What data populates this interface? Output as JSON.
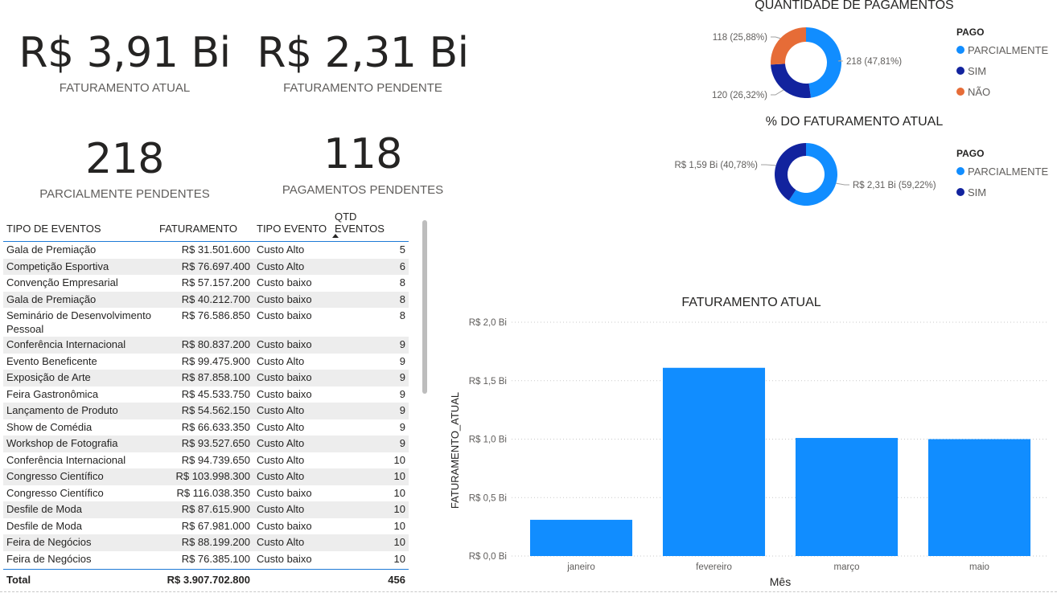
{
  "kpis": {
    "faturamento_atual": {
      "value": "R$ 3,91 Bi",
      "label": "FATURAMENTO ATUAL"
    },
    "faturamento_pendente": {
      "value": "R$ 2,31 Bi",
      "label": "FATURAMENTO PENDENTE"
    },
    "parcialmente_pendentes": {
      "value": "218",
      "label": "PARCIALMENTE PENDENTES"
    },
    "pagamentos_pendentes": {
      "value": "118",
      "label": "PAGAMENTOS PENDENTES"
    }
  },
  "colors": {
    "parcialmente": "#118DFF",
    "sim": "#12239E",
    "nao": "#E66C37"
  },
  "table": {
    "headers": [
      "TIPO DE EVENTOS",
      "FATURAMENTO",
      "TIPO EVENTO",
      "QTD EVENTOS"
    ],
    "rows": [
      [
        "Gala de Premiação",
        "R$ 31.501.600",
        "Custo Alto",
        "5"
      ],
      [
        "Competição Esportiva",
        "R$ 76.697.400",
        "Custo Alto",
        "6"
      ],
      [
        "Convenção Empresarial",
        "R$ 57.157.200",
        "Custo baixo",
        "8"
      ],
      [
        "Gala de Premiação",
        "R$ 40.212.700",
        "Custo baixo",
        "8"
      ],
      [
        "Seminário de Desenvolvimento Pessoal",
        "R$ 76.586.850",
        "Custo baixo",
        "8"
      ],
      [
        "Conferência Internacional",
        "R$ 80.837.200",
        "Custo baixo",
        "9"
      ],
      [
        "Evento Beneficente",
        "R$ 99.475.900",
        "Custo Alto",
        "9"
      ],
      [
        "Exposição de Arte",
        "R$ 87.858.100",
        "Custo baixo",
        "9"
      ],
      [
        "Feira Gastronômica",
        "R$ 45.533.750",
        "Custo baixo",
        "9"
      ],
      [
        "Lançamento de Produto",
        "R$ 54.562.150",
        "Custo Alto",
        "9"
      ],
      [
        "Show de Comédia",
        "R$ 66.633.350",
        "Custo Alto",
        "9"
      ],
      [
        "Workshop de Fotografia",
        "R$ 93.527.650",
        "Custo Alto",
        "9"
      ],
      [
        "Conferência Internacional",
        "R$ 94.739.650",
        "Custo Alto",
        "10"
      ],
      [
        "Congresso Científico",
        "R$ 103.998.300",
        "Custo Alto",
        "10"
      ],
      [
        "Congresso Científico",
        "R$ 116.038.350",
        "Custo baixo",
        "10"
      ],
      [
        "Desfile de Moda",
        "R$ 87.615.900",
        "Custo Alto",
        "10"
      ],
      [
        "Desfile de Moda",
        "R$ 67.981.000",
        "Custo baixo",
        "10"
      ],
      [
        "Feira de Negócios",
        "R$ 88.199.200",
        "Custo Alto",
        "10"
      ],
      [
        "Feira de Negócios",
        "R$ 76.385.100",
        "Custo baixo",
        "10"
      ]
    ],
    "total": {
      "label": "Total",
      "faturamento": "R$ 3.907.702.800",
      "qtd": "456"
    }
  },
  "chart_data": [
    {
      "type": "pie",
      "title": "QUANTIDADE DE PAGAMENTOS",
      "legend_title": "PAGO",
      "legend": [
        "PARCIALMENTE",
        "SIM",
        "NÃO"
      ],
      "slices": [
        {
          "name": "PARCIALMENTE",
          "value": 218,
          "label": "218 (47,81%)"
        },
        {
          "name": "SIM",
          "value": 120,
          "label": "120 (26,32%)"
        },
        {
          "name": "NÃO",
          "value": 118,
          "label": "118 (25,88%)"
        }
      ]
    },
    {
      "type": "pie",
      "title": "% DO FATURAMENTO ATUAL",
      "legend_title": "PAGO",
      "legend": [
        "PARCIALMENTE",
        "SIM"
      ],
      "slices": [
        {
          "name": "PARCIALMENTE",
          "value": 2.31,
          "label": "R$ 2,31 Bi (59,22%)"
        },
        {
          "name": "SIM",
          "value": 1.59,
          "label": "R$ 1,59 Bi (40,78%)"
        }
      ]
    },
    {
      "type": "bar",
      "title": "FATURAMENTO ATUAL",
      "xlabel": "Mês",
      "ylabel": "FATURAMENTO_ATUAL",
      "categories": [
        "janeiro",
        "fevereiro",
        "março",
        "maio"
      ],
      "values": [
        0.31,
        1.61,
        1.01,
        1.0
      ],
      "ylim": [
        0,
        2.0
      ],
      "yticks": [
        0,
        0.5,
        1.0,
        1.5,
        2.0
      ],
      "ytick_labels": [
        "R$ 0,0 Bi",
        "R$ 0,5 Bi",
        "R$ 1,0 Bi",
        "R$ 1,5 Bi",
        "R$ 2,0 Bi"
      ],
      "grid": true
    }
  ]
}
